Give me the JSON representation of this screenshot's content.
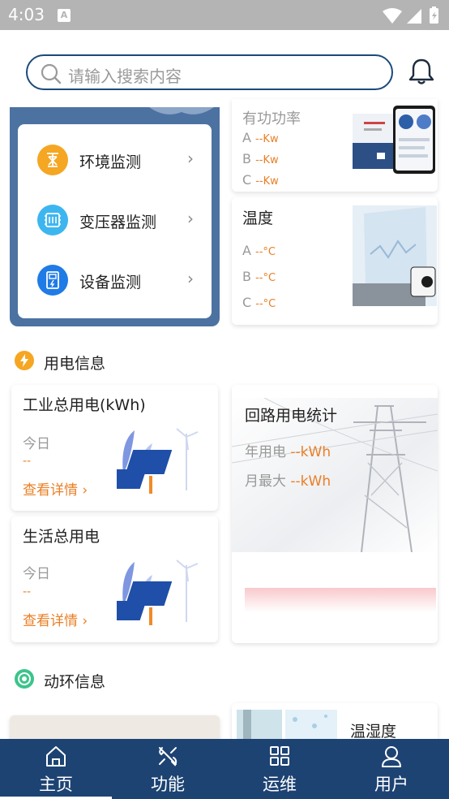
{
  "status": {
    "time": "4:03",
    "a_icon": "A"
  },
  "search": {
    "placeholder": "请输入搜索内容"
  },
  "monitor_menu": [
    {
      "label": "环境监测",
      "icon": "environment-icon",
      "color": "#f5a623"
    },
    {
      "label": "变压器监测",
      "icon": "transformer-icon",
      "color": "#3db6f0"
    },
    {
      "label": "设备监测",
      "icon": "device-icon",
      "color": "#1f7be6"
    }
  ],
  "power_card": {
    "title": "有功功率",
    "rows": [
      {
        "phase": "A",
        "value": "--Kw"
      },
      {
        "phase": "B",
        "value": "--Kw"
      },
      {
        "phase": "C",
        "value": "--Kw"
      }
    ]
  },
  "temp_card": {
    "title": "温度",
    "rows": [
      {
        "phase": "A",
        "value": "--°C"
      },
      {
        "phase": "B",
        "value": "--°C"
      },
      {
        "phase": "C",
        "value": "--°C"
      }
    ]
  },
  "electricity_section": {
    "title": "用电信息"
  },
  "industrial": {
    "title": "工业总用电(kWh)",
    "today_label": "今日",
    "today_value": "--",
    "detail": "查看详情"
  },
  "domestic": {
    "title": "生活总用电",
    "today_label": "今日",
    "today_value": "--",
    "detail": "查看详情"
  },
  "circuit": {
    "title": "回路用电统计",
    "year_label": "年用电",
    "year_value": "--kWh",
    "month_label": "月最大",
    "month_value": "--kWh"
  },
  "env_section": {
    "title": "动环信息"
  },
  "humidity": {
    "title": "温湿度"
  },
  "tabs": [
    {
      "label": "主页",
      "icon": "home-icon",
      "active": true
    },
    {
      "label": "功能",
      "icon": "tools-icon",
      "active": false
    },
    {
      "label": "运维",
      "icon": "grid-icon",
      "active": false
    },
    {
      "label": "用户",
      "icon": "user-icon",
      "active": false
    }
  ]
}
